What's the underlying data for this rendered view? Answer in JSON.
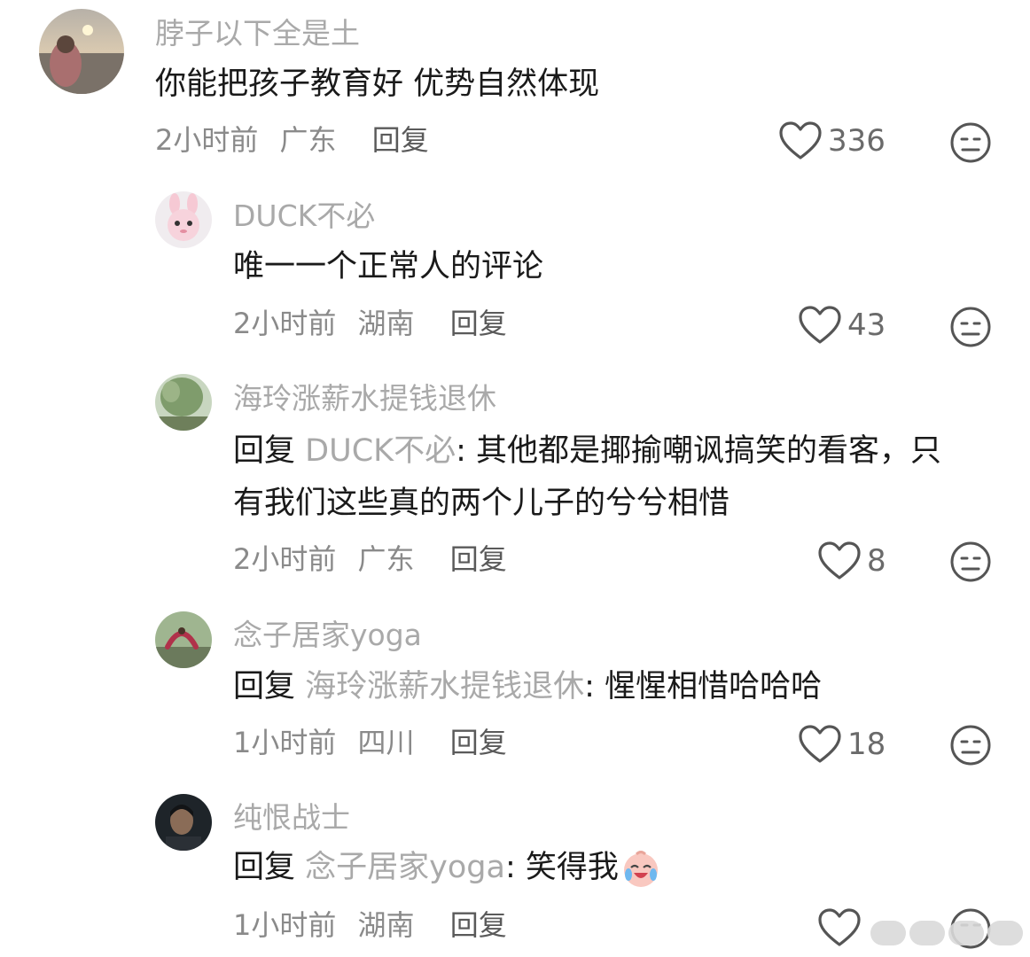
{
  "comments": [
    {
      "username": "脖子以下全是土",
      "content": "你能把孩子教育好 优势自然体现",
      "time": "2小时前",
      "location": "广东",
      "reply_label": "回复",
      "likes": "336"
    },
    {
      "username": "DUCK不必",
      "content": "唯一一个正常人的评论",
      "time": "2小时前",
      "location": "湖南",
      "reply_label": "回复",
      "likes": "43"
    },
    {
      "username": "海玲涨薪水提钱退休",
      "reply_prefix": "回复",
      "mention": "DUCK不必",
      "content_line1": ": 其他都是揶揄嘲讽搞笑的看客，只",
      "content_line2": "有我们这些真的两个儿子的兮兮相惜",
      "time": "2小时前",
      "location": "广东",
      "reply_label": "回复",
      "likes": "8"
    },
    {
      "username": "念子居家yoga",
      "reply_prefix": "回复",
      "mention": "海玲涨薪水提钱退休",
      "content": ": 惺惺相惜哈哈哈",
      "time": "1小时前",
      "location": "四川",
      "reply_label": "回复",
      "likes": "18"
    },
    {
      "username": "纯恨战士",
      "reply_prefix": "回复",
      "mention": "念子居家yoga",
      "content": ": 笑得我",
      "time": "1小时前",
      "location": "湖南",
      "reply_label": "回复"
    }
  ],
  "icons": {
    "like": "heart-outline-icon",
    "dislike": "neutral-face-icon",
    "laugh_cry": "laugh-crying-emoji"
  },
  "colors": {
    "username": "#a9a9a9",
    "content": "#1a1a1a",
    "meta": "#8a8a8a"
  }
}
